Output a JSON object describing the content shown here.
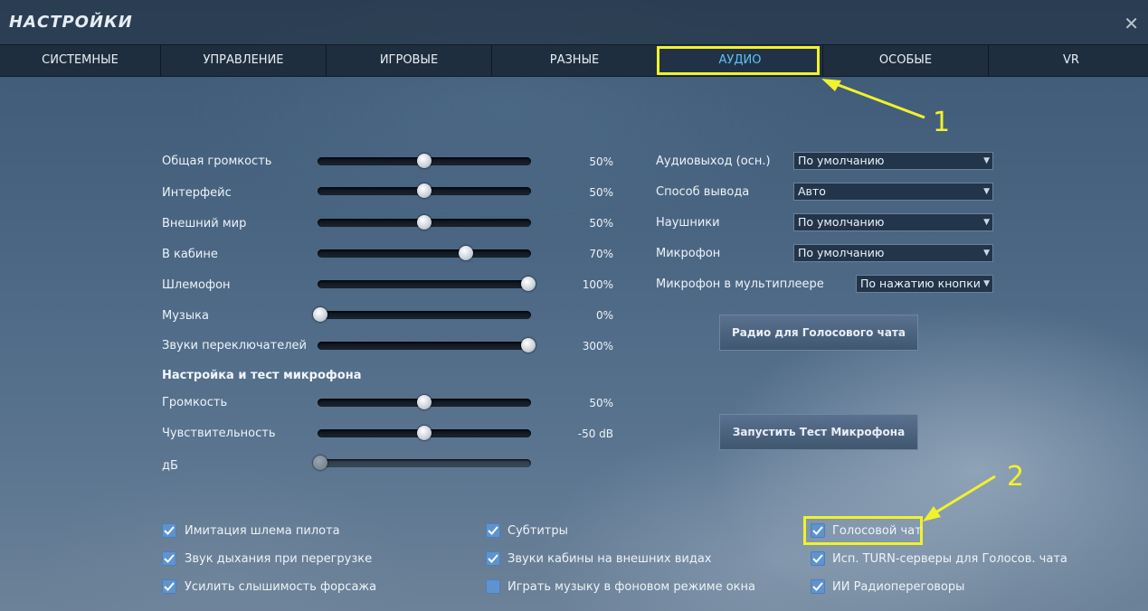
{
  "window": {
    "title": "НАСТРОЙКИ",
    "close_glyph": "✕"
  },
  "tabs": [
    "СИСТЕМНЫЕ",
    "УПРАВЛЕНИЕ",
    "ИГРОВЫЕ",
    "РАЗНЫЕ",
    "АУДИО",
    "ОСОБЫЕ",
    "VR"
  ],
  "active_tab": "АУДИО",
  "annotations": {
    "marker1": "1",
    "marker2": "2"
  },
  "volume": [
    {
      "label": "Общая громкость",
      "value": "50%",
      "level": 0.5
    },
    {
      "label": "Интерфейс",
      "value": "50%",
      "level": 0.5
    },
    {
      "label": "Внешний мир",
      "value": "50%",
      "level": 0.5
    },
    {
      "label": "В кабине",
      "value": "70%",
      "level": 0.7
    },
    {
      "label": "Шлемофон",
      "value": "100%",
      "level": 1.0
    },
    {
      "label": "Музыка",
      "value": "0%",
      "level": 0.0
    },
    {
      "label": "Звуки переключателей",
      "value": "300%",
      "level": 1.0
    }
  ],
  "mic_section": {
    "title": "Настройка и тест микрофона",
    "gain": {
      "label": "Громкость",
      "value": "50%",
      "level": 0.5
    },
    "sensitivity": {
      "label": "Чувствительность",
      "value": "-50 dB",
      "level": 0.5
    },
    "db": {
      "label": "дБ",
      "level": 0.0
    }
  },
  "devices": {
    "output": {
      "label": "Аудиовыход (осн.)",
      "value": "По умолчанию"
    },
    "mode": {
      "label": "Способ вывода",
      "value": "Авто"
    },
    "headphones": {
      "label": "Наушники",
      "value": "По умолчанию"
    },
    "mic": {
      "label": "Микрофон",
      "value": "По умолчанию"
    },
    "mp_mic": {
      "label": "Микрофон в мультиплеере",
      "value": "По нажатию кнопки"
    }
  },
  "buttons": {
    "radio": "Радио для Голосового чата",
    "mic_test": "Запустить Тест Микрофона"
  },
  "checks": {
    "helmet": {
      "label": "Имитация шлема пилота",
      "checked": true
    },
    "breath": {
      "label": "Звук дыхания при перегрузке",
      "checked": true
    },
    "afterburner": {
      "label": "Усилить слышимость форсажа",
      "checked": true
    },
    "subtitles": {
      "label": "Субтитры",
      "checked": true
    },
    "cockpit_ext": {
      "label": "Звуки кабины на внешних видах",
      "checked": true
    },
    "bg_music": {
      "label": "Играть музыку в фоновом режиме окна",
      "checked": false
    },
    "voice_chat": {
      "label": "Голосовой чат",
      "checked": true
    },
    "turn": {
      "label": "Исп. TURN-серверы для Голосов. чата",
      "checked": true
    },
    "ai_radio": {
      "label": "ИИ Радиопереговоры",
      "checked": true
    }
  },
  "colors": {
    "accent": "#5ec2f2",
    "highlight": "#f2f22a",
    "checkbox": "#5f93d0"
  }
}
